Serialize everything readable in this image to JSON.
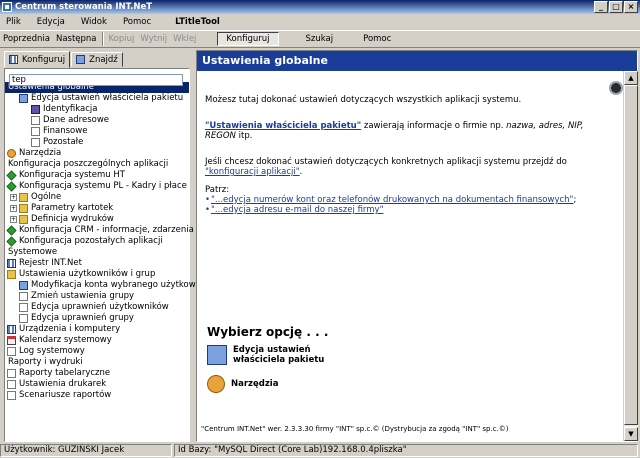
{
  "window": {
    "title": "Centrum sterowania INT.NeT"
  },
  "menu": {
    "items": [
      "Plik",
      "Edycja",
      "Widok",
      "Pomoc"
    ],
    "ltitle": "LTitleTool"
  },
  "toolbar": {
    "back": "Poprzednia",
    "next": "Następna",
    "copy": "Kopiuj",
    "cut": "Wytnij",
    "paste": "Wklej",
    "configure": "Konfiguruj",
    "search": "Szukaj",
    "help": "Pomoc"
  },
  "tabs": {
    "configure": "Konfiguruj",
    "find": "Znajdź"
  },
  "filter": {
    "value": "tep"
  },
  "tree": [
    {
      "label": "Ustawienia globalne",
      "level": 0,
      "icon": "none",
      "selected": true
    },
    {
      "label": "Edycja ustawień właściciela pakietu",
      "level": 1,
      "icon": "pen"
    },
    {
      "label": "Identyfikacja",
      "level": 2,
      "icon": "book"
    },
    {
      "label": "Dane adresowe",
      "level": 2,
      "icon": "doc"
    },
    {
      "label": "Finansowe",
      "level": 2,
      "icon": "doc"
    },
    {
      "label": "Pozostałe",
      "level": 2,
      "icon": "doc"
    },
    {
      "label": "Narzędzia",
      "level": 0,
      "icon": "tools"
    },
    {
      "label": "Konfiguracja poszczególnych aplikacji",
      "level": 0,
      "icon": "none"
    },
    {
      "label": "Konfiguracja systemu HT",
      "level": 0,
      "icon": "green"
    },
    {
      "label": "Konfiguracja systemu PL - Kadry i płace",
      "level": 0,
      "icon": "green"
    },
    {
      "label": "Ogólne",
      "level": 1,
      "icon": "folder",
      "expand": true
    },
    {
      "label": "Parametry kartotek",
      "level": 1,
      "icon": "folder",
      "expand": true
    },
    {
      "label": "Definicja wydruków",
      "level": 1,
      "icon": "folder",
      "expand": true
    },
    {
      "label": "Konfiguracja CRM - informacje, zdarzenia",
      "level": 0,
      "icon": "green"
    },
    {
      "label": "Konfiguracja pozostałych aplikacji",
      "level": 0,
      "icon": "green"
    },
    {
      "label": "Systemowe",
      "level": 0,
      "icon": "none"
    },
    {
      "label": "Rejestr INT.Net",
      "level": 0,
      "icon": "grid"
    },
    {
      "label": "Ustawienia użytkowników i grup",
      "level": 0,
      "icon": "folder"
    },
    {
      "label": "Modyfikacja konta wybranego użytkownika",
      "level": 1,
      "icon": "pen"
    },
    {
      "label": "Zmień ustawienia grupy",
      "level": 1,
      "icon": "doc"
    },
    {
      "label": "Edycja uprawnień użytkowników",
      "level": 1,
      "icon": "doc"
    },
    {
      "label": "Edycja uprawnień grupy",
      "level": 1,
      "icon": "doc"
    },
    {
      "label": "Urządzenia i komputery",
      "level": 0,
      "icon": "grid"
    },
    {
      "label": "Kalendarz systemowy",
      "level": 0,
      "icon": "cal"
    },
    {
      "label": "Log systemowy",
      "level": 0,
      "icon": "doc"
    },
    {
      "label": "Raporty i wydruki",
      "level": 0,
      "icon": "none"
    },
    {
      "label": "Raporty tabelaryczne",
      "level": 0,
      "icon": "doc"
    },
    {
      "label": "Ustawienia drukarek",
      "level": 0,
      "icon": "doc"
    },
    {
      "label": "Scenariusze raportów",
      "level": 0,
      "icon": "doc"
    }
  ],
  "panel": {
    "header": "Ustawienia globalne",
    "intro": "Możesz tutaj dokonać ustawień dotyczących wszystkich aplikacji systemu.",
    "owner_link": "\"Ustawienia właściciela pakietu\"",
    "owner_text_pre": " zawierają informacje o firmie np. ",
    "owner_italic1": "nazwa, adres, NIP,",
    "owner_italic2": "REGON",
    "owner_text_post": " itp.",
    "specific_text": "Jeśli chcesz dokonać ustawień dotyczących konkretnych aplikacji systemu przejdź do",
    "specific_link": "\"konfiguracji aplikacji\"",
    "specific_dot": ".",
    "see": "Patrz:",
    "see_links": [
      "\"...edycja numerów kont oraz telefonów drukowanych na dokumentach finansowych\"",
      "\"...edycja adresu e-mail do naszej firmy\""
    ],
    "see_suffix": [
      ";",
      ""
    ],
    "choose": "Wybierz opcję . . .",
    "option1_line1": "Edycja ustawień",
    "option1_line2": "właściciela pakietu",
    "option2": "Narzędzia",
    "footer": "\"Centrum INT.Net\" wer. 2.3.3.30 firmy \"INT\" sp.c.© (Dystrybucja za zgodą \"INT\" sp.c.©)"
  },
  "status": {
    "user": "Użytkownik: GUZIŃSKI Jacek",
    "db": "Id Bazy: \"MySQL Direct (Core Lab)192.168.0.4pliszka\""
  }
}
